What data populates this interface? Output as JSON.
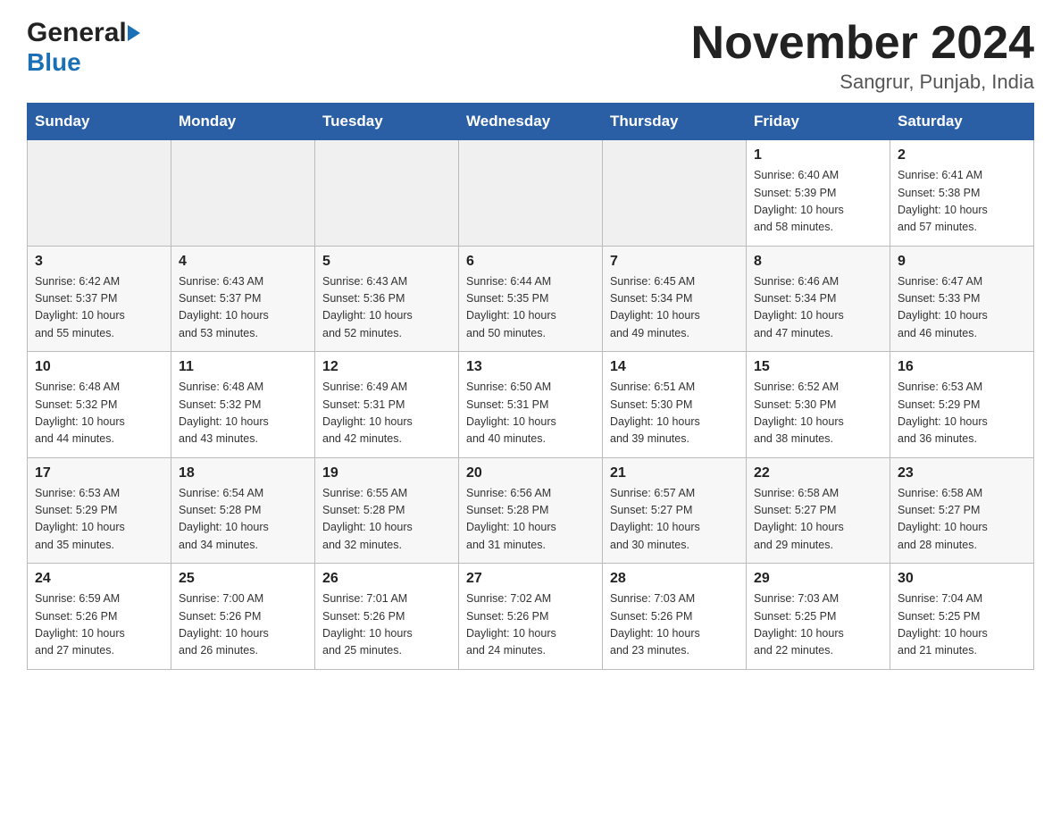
{
  "header": {
    "logo_general": "General",
    "logo_blue": "Blue",
    "month_year": "November 2024",
    "location": "Sangrur, Punjab, India"
  },
  "weekdays": [
    "Sunday",
    "Monday",
    "Tuesday",
    "Wednesday",
    "Thursday",
    "Friday",
    "Saturday"
  ],
  "weeks": [
    [
      {
        "day": "",
        "info": ""
      },
      {
        "day": "",
        "info": ""
      },
      {
        "day": "",
        "info": ""
      },
      {
        "day": "",
        "info": ""
      },
      {
        "day": "",
        "info": ""
      },
      {
        "day": "1",
        "info": "Sunrise: 6:40 AM\nSunset: 5:39 PM\nDaylight: 10 hours\nand 58 minutes."
      },
      {
        "day": "2",
        "info": "Sunrise: 6:41 AM\nSunset: 5:38 PM\nDaylight: 10 hours\nand 57 minutes."
      }
    ],
    [
      {
        "day": "3",
        "info": "Sunrise: 6:42 AM\nSunset: 5:37 PM\nDaylight: 10 hours\nand 55 minutes."
      },
      {
        "day": "4",
        "info": "Sunrise: 6:43 AM\nSunset: 5:37 PM\nDaylight: 10 hours\nand 53 minutes."
      },
      {
        "day": "5",
        "info": "Sunrise: 6:43 AM\nSunset: 5:36 PM\nDaylight: 10 hours\nand 52 minutes."
      },
      {
        "day": "6",
        "info": "Sunrise: 6:44 AM\nSunset: 5:35 PM\nDaylight: 10 hours\nand 50 minutes."
      },
      {
        "day": "7",
        "info": "Sunrise: 6:45 AM\nSunset: 5:34 PM\nDaylight: 10 hours\nand 49 minutes."
      },
      {
        "day": "8",
        "info": "Sunrise: 6:46 AM\nSunset: 5:34 PM\nDaylight: 10 hours\nand 47 minutes."
      },
      {
        "day": "9",
        "info": "Sunrise: 6:47 AM\nSunset: 5:33 PM\nDaylight: 10 hours\nand 46 minutes."
      }
    ],
    [
      {
        "day": "10",
        "info": "Sunrise: 6:48 AM\nSunset: 5:32 PM\nDaylight: 10 hours\nand 44 minutes."
      },
      {
        "day": "11",
        "info": "Sunrise: 6:48 AM\nSunset: 5:32 PM\nDaylight: 10 hours\nand 43 minutes."
      },
      {
        "day": "12",
        "info": "Sunrise: 6:49 AM\nSunset: 5:31 PM\nDaylight: 10 hours\nand 42 minutes."
      },
      {
        "day": "13",
        "info": "Sunrise: 6:50 AM\nSunset: 5:31 PM\nDaylight: 10 hours\nand 40 minutes."
      },
      {
        "day": "14",
        "info": "Sunrise: 6:51 AM\nSunset: 5:30 PM\nDaylight: 10 hours\nand 39 minutes."
      },
      {
        "day": "15",
        "info": "Sunrise: 6:52 AM\nSunset: 5:30 PM\nDaylight: 10 hours\nand 38 minutes."
      },
      {
        "day": "16",
        "info": "Sunrise: 6:53 AM\nSunset: 5:29 PM\nDaylight: 10 hours\nand 36 minutes."
      }
    ],
    [
      {
        "day": "17",
        "info": "Sunrise: 6:53 AM\nSunset: 5:29 PM\nDaylight: 10 hours\nand 35 minutes."
      },
      {
        "day": "18",
        "info": "Sunrise: 6:54 AM\nSunset: 5:28 PM\nDaylight: 10 hours\nand 34 minutes."
      },
      {
        "day": "19",
        "info": "Sunrise: 6:55 AM\nSunset: 5:28 PM\nDaylight: 10 hours\nand 32 minutes."
      },
      {
        "day": "20",
        "info": "Sunrise: 6:56 AM\nSunset: 5:28 PM\nDaylight: 10 hours\nand 31 minutes."
      },
      {
        "day": "21",
        "info": "Sunrise: 6:57 AM\nSunset: 5:27 PM\nDaylight: 10 hours\nand 30 minutes."
      },
      {
        "day": "22",
        "info": "Sunrise: 6:58 AM\nSunset: 5:27 PM\nDaylight: 10 hours\nand 29 minutes."
      },
      {
        "day": "23",
        "info": "Sunrise: 6:58 AM\nSunset: 5:27 PM\nDaylight: 10 hours\nand 28 minutes."
      }
    ],
    [
      {
        "day": "24",
        "info": "Sunrise: 6:59 AM\nSunset: 5:26 PM\nDaylight: 10 hours\nand 27 minutes."
      },
      {
        "day": "25",
        "info": "Sunrise: 7:00 AM\nSunset: 5:26 PM\nDaylight: 10 hours\nand 26 minutes."
      },
      {
        "day": "26",
        "info": "Sunrise: 7:01 AM\nSunset: 5:26 PM\nDaylight: 10 hours\nand 25 minutes."
      },
      {
        "day": "27",
        "info": "Sunrise: 7:02 AM\nSunset: 5:26 PM\nDaylight: 10 hours\nand 24 minutes."
      },
      {
        "day": "28",
        "info": "Sunrise: 7:03 AM\nSunset: 5:26 PM\nDaylight: 10 hours\nand 23 minutes."
      },
      {
        "day": "29",
        "info": "Sunrise: 7:03 AM\nSunset: 5:25 PM\nDaylight: 10 hours\nand 22 minutes."
      },
      {
        "day": "30",
        "info": "Sunrise: 7:04 AM\nSunset: 5:25 PM\nDaylight: 10 hours\nand 21 minutes."
      }
    ]
  ]
}
